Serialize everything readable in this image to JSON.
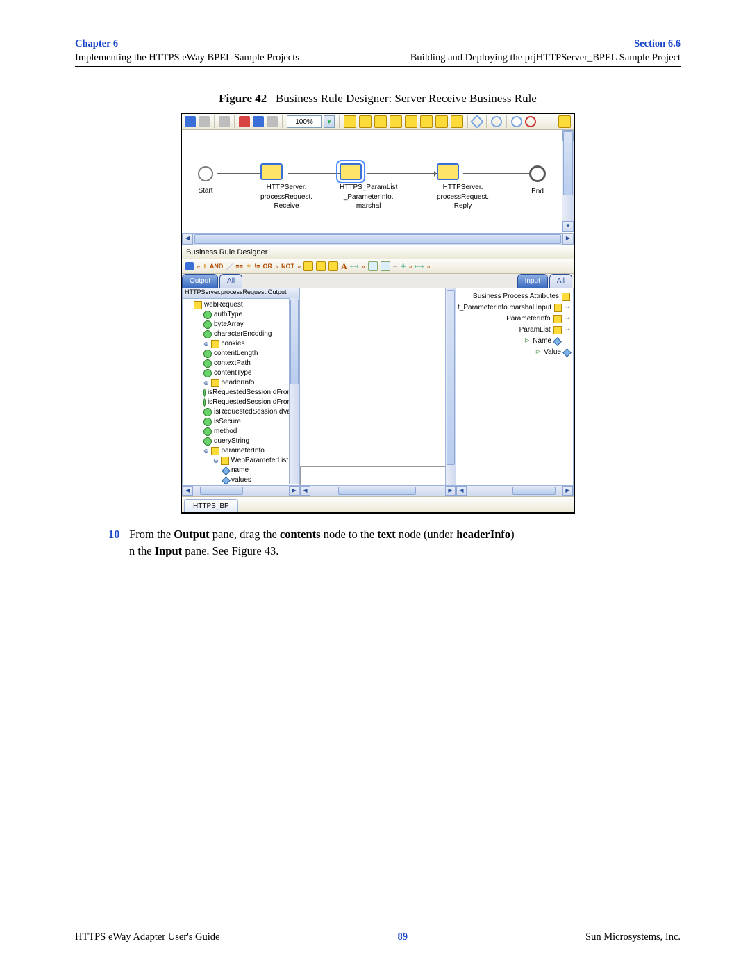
{
  "header": {
    "chapter": "Chapter 6",
    "section": "Section 6.6",
    "left_sub": "Implementing the HTTPS eWay BPEL Sample Projects",
    "right_sub": "Building and Deploying the prjHTTPServer_BPEL Sample Project"
  },
  "figure": {
    "label": "Figure 42",
    "title": "Business Rule Designer: Server Receive Business Rule"
  },
  "toolbar": {
    "zoom": "100%"
  },
  "flow": {
    "start": "Start",
    "node1a": "HTTPServer.",
    "node1b": "processRequest.",
    "node1c": "Receive",
    "node2a": "HTTPS_ParamList",
    "node2b": "_ParameterInfo.",
    "node2c": "marshal",
    "node3a": "HTTPServer.",
    "node3b": "processRequest.",
    "node3c": "Reply",
    "end": "End"
  },
  "designer": {
    "title": "Business Rule Designer",
    "ops": [
      "AND",
      "==",
      "!=",
      "OR",
      "NOT",
      "A"
    ]
  },
  "tabs": {
    "output": "Output",
    "all_l": "All",
    "input": "Input",
    "all_r": "All"
  },
  "left_panel": {
    "header": "HTTPServer.processRequest.Output",
    "items": [
      "webRequest",
      "authType",
      "byteArray",
      "characterEncoding",
      "cookies",
      "contentLength",
      "contextPath",
      "contentType",
      "headerInfo",
      "isRequestedSessionIdFromC",
      "isRequestedSessionIdFromU",
      "isRequestedSessionIdValid",
      "isSecure",
      "method",
      "queryString",
      "parameterInfo",
      "WebParameterList",
      "name",
      "values"
    ]
  },
  "right_panel": {
    "items": [
      "Business Process Attributes",
      "t_ParameterInfo.marshal.Input",
      "ParameterInfo",
      "ParamList",
      "Name",
      "Value"
    ]
  },
  "status_tab": "HTTPS_BP",
  "body": {
    "step_num": "10",
    "line1_a": "From the ",
    "line1_b": "Output",
    "line1_c": " pane, drag the ",
    "line1_d": "contents",
    "line1_e": " node to the ",
    "line1_f": "text",
    "line1_g": " node (under ",
    "line1_h": "headerInfo",
    "line1_i": ") ",
    "line2_a": "n the ",
    "line2_b": "Input",
    "line2_c": " pane. See Figure 43."
  },
  "footer": {
    "left": "HTTPS eWay Adapter User's Guide",
    "page": "89",
    "right": "Sun Microsystems, Inc."
  }
}
